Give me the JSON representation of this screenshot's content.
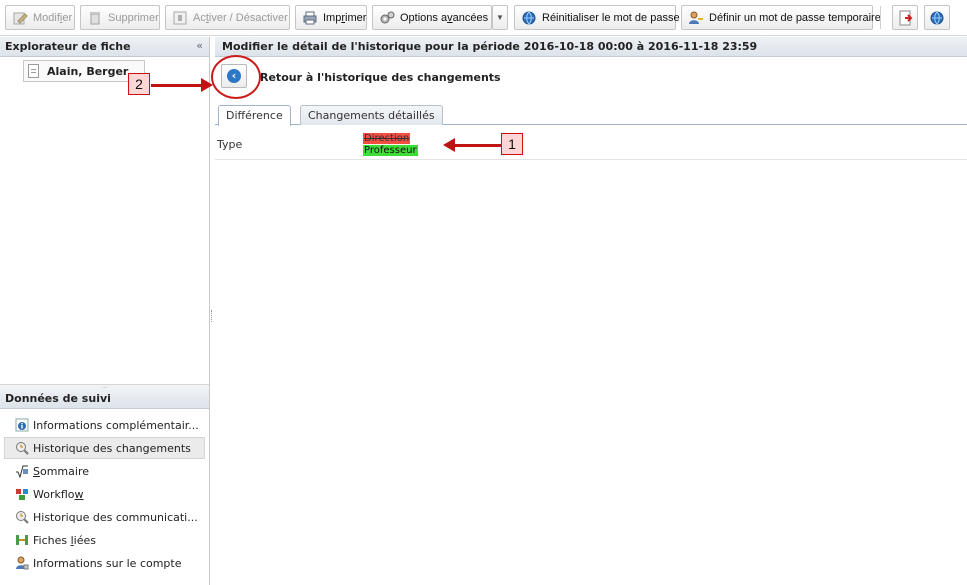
{
  "toolbar": {
    "modify": {
      "label_pre": "Modif",
      "label_u": "i",
      "label_post": "er"
    },
    "delete": {
      "label": "Supprimer"
    },
    "toggle": {
      "label_pre": "Ac",
      "label_u": "t",
      "label_post": "iver / Désactiver"
    },
    "print": {
      "label_pre": "Imp",
      "label_u": "r",
      "label_post": "imer"
    },
    "advanced": {
      "label_pre": "Options a",
      "label_u": "v",
      "label_post": "ancées"
    },
    "reset_password": {
      "label": "Réinitialiser le mot de passe"
    },
    "temp_password": {
      "label": "Définir un mot de passe temporaire"
    }
  },
  "left_panel": {
    "explorer_title": "Explorateur de fiche",
    "collapse_glyph": "«",
    "file_item": "Alain, Berger",
    "suivi_title": "Données de suivi",
    "grip": "...",
    "items": [
      {
        "label": "Informations complémentair..."
      },
      {
        "label": "Historique des changements"
      },
      {
        "label_u": "S",
        "label_post": "ommaire"
      },
      {
        "label_pre": "Workflo",
        "label_u": "w"
      },
      {
        "label": "Historique des communicati..."
      },
      {
        "label_pre": "Fiches ",
        "label_u": "l",
        "label_post": "iées"
      },
      {
        "label": "Informations sur le compte"
      }
    ]
  },
  "main": {
    "header": "Modifier le détail de l'historique pour la période 2016-10-18 00:00 à 2016-11-18 23:59",
    "back_glyph": "‹",
    "back_label": "Retour à l'historique des changements",
    "tabs": [
      {
        "label": "Différence"
      },
      {
        "label": "Changements détaillés"
      }
    ],
    "diff": {
      "field": "Type",
      "old_value": "Direction",
      "new_value": "Professeur"
    }
  },
  "annotations": {
    "callout_1": "1",
    "callout_2": "2"
  },
  "colors": {
    "removed": "#f24f43",
    "added": "#3fdc35",
    "annotation": "#c01414"
  }
}
